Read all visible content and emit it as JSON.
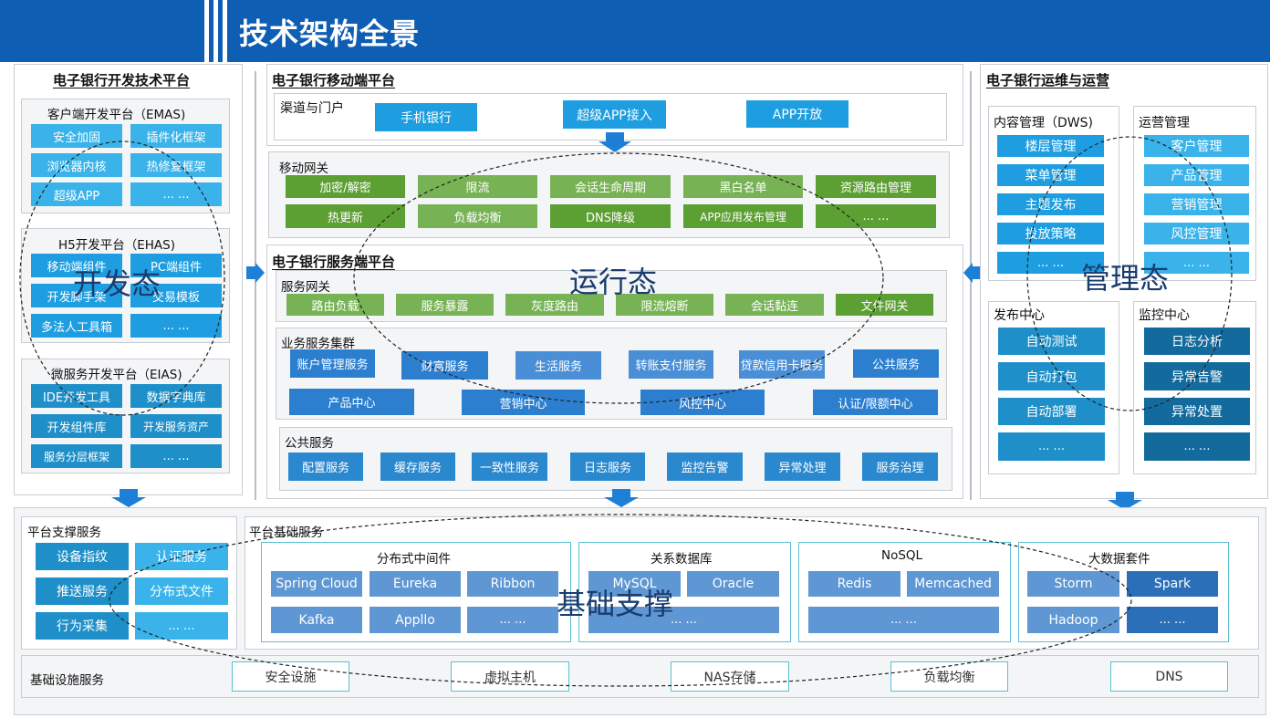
{
  "header": {
    "title": "技术架构全景"
  },
  "left": {
    "title": "电子银行开发技术平台",
    "emas": {
      "title": "客户端开发平台（EMAS)",
      "items": [
        "安全加固",
        "插件化框架",
        "浏览器内核",
        "热修复框架",
        "超级APP",
        "... ..."
      ]
    },
    "ehas": {
      "title": "H5开发平台（EHAS)",
      "items": [
        "移动端组件",
        "PC端组件",
        "开发脚手架",
        "交易模板",
        "多法人工具箱",
        "... ..."
      ]
    },
    "eias": {
      "title": "微服务开发平台（EIAS)",
      "items": [
        "IDE开发工具",
        "数据字典库",
        "开发组件库",
        "开发服务资产",
        "服务分层框架",
        "... ..."
      ]
    }
  },
  "mobile": {
    "title": "电子银行移动端平台",
    "channel": {
      "title": "渠道与门户",
      "items": [
        "手机银行",
        "超级APP接入",
        "APP开放"
      ]
    },
    "gateway": {
      "title": "移动网关",
      "items": [
        "加密/解密",
        "限流",
        "会话生命周期",
        "黑白名单",
        "资源路由管理",
        "热更新",
        "负载均衡",
        "DNS降级",
        "APP应用发布管理",
        "... ..."
      ]
    }
  },
  "server": {
    "title": "电子银行服务端平台",
    "gateway": {
      "title": "服务网关",
      "items": [
        "路由负载",
        "服务暴露",
        "灰度路由",
        "限流熔断",
        "会话黏连",
        "文件网关"
      ]
    },
    "business": {
      "title": "业务服务集群",
      "row1": [
        "账户管理服务",
        "财富服务",
        "生活服务",
        "转账支付服务",
        "贷款信用卡服务",
        "公共服务"
      ],
      "row2": [
        "产品中心",
        "营销中心",
        "风控中心",
        "认证/限额中心"
      ]
    },
    "public": {
      "title": "公共服务",
      "items": [
        "配置服务",
        "缓存服务",
        "一致性服务",
        "日志服务",
        "监控告警",
        "异常处理",
        "服务治理"
      ]
    }
  },
  "ops": {
    "title": "电子银行运维与运营",
    "content": {
      "title": "内容管理（DWS)",
      "items": [
        "楼层管理",
        "菜单管理",
        "主题发布",
        "投放策略",
        "... ..."
      ]
    },
    "operation": {
      "title": "运营管理",
      "items": [
        "客户管理",
        "产品管理",
        "营销管理",
        "风控管理",
        "... ..."
      ]
    },
    "release": {
      "title": "发布中心",
      "items": [
        "自动测试",
        "自动打包",
        "自动部署",
        "... ..."
      ]
    },
    "monitor": {
      "title": "监控中心",
      "items": [
        "日志分析",
        "异常告警",
        "异常处置",
        "... ..."
      ]
    }
  },
  "bottom": {
    "support": {
      "title": "平台支撑服务",
      "items": [
        "设备指纹",
        "认证服务",
        "推送服务",
        "分布式文件",
        "行为采集",
        "... ..."
      ]
    },
    "base": {
      "title": "平台基础服务",
      "middleware": {
        "title": "分布式中间件",
        "items": [
          "Spring Cloud",
          "Eureka",
          "Ribbon",
          "Kafka",
          "Appllo",
          "... ..."
        ]
      },
      "rdb": {
        "title": "关系数据库",
        "items": [
          "MySQL",
          "Oracle",
          "... ..."
        ]
      },
      "nosql": {
        "title": "NoSQL",
        "items": [
          "Redis",
          "Memcached",
          "... ..."
        ]
      },
      "bigdata": {
        "title": "大数据套件",
        "items": [
          "Storm",
          "Spark",
          "Hadoop",
          "... ..."
        ]
      }
    },
    "infra": {
      "title": "基础设施服务",
      "items": [
        "安全设施",
        "虚拟主机",
        "NAS存储",
        "负载均衡",
        "DNS"
      ]
    }
  },
  "overlays": {
    "dev": "开发态",
    "run": "运行态",
    "manage": "管理态",
    "base": "基础支撑"
  },
  "colors": {
    "header": "#0e5eb3",
    "green": "#77b354",
    "blue": "#1e9ee0"
  }
}
